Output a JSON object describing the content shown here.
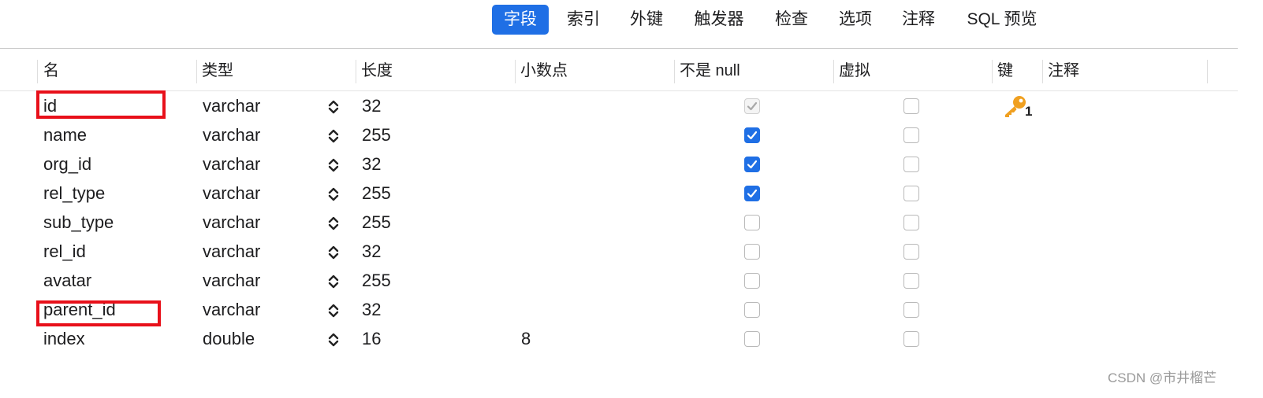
{
  "tabs": [
    {
      "label": "字段",
      "active": true
    },
    {
      "label": "索引",
      "active": false
    },
    {
      "label": "外键",
      "active": false
    },
    {
      "label": "触发器",
      "active": false
    },
    {
      "label": "检查",
      "active": false
    },
    {
      "label": "选项",
      "active": false
    },
    {
      "label": "注释",
      "active": false
    },
    {
      "label": "SQL 预览",
      "active": false
    }
  ],
  "columns": {
    "name": "名",
    "type": "类型",
    "length": "长度",
    "decimals": "小数点",
    "not_null": "不是 null",
    "virtual": "虚拟",
    "key": "键",
    "comment": "注释"
  },
  "fields": [
    {
      "name": "id",
      "type": "varchar",
      "length": "32",
      "decimals": "",
      "not_null": true,
      "not_null_disabled": true,
      "virtual": false,
      "key": "1",
      "comment": "",
      "highlighted": true
    },
    {
      "name": "name",
      "type": "varchar",
      "length": "255",
      "decimals": "",
      "not_null": true,
      "not_null_disabled": false,
      "virtual": false,
      "key": "",
      "comment": "",
      "highlighted": false
    },
    {
      "name": "org_id",
      "type": "varchar",
      "length": "32",
      "decimals": "",
      "not_null": true,
      "not_null_disabled": false,
      "virtual": false,
      "key": "",
      "comment": "",
      "highlighted": false
    },
    {
      "name": "rel_type",
      "type": "varchar",
      "length": "255",
      "decimals": "",
      "not_null": true,
      "not_null_disabled": false,
      "virtual": false,
      "key": "",
      "comment": "",
      "highlighted": false
    },
    {
      "name": "sub_type",
      "type": "varchar",
      "length": "255",
      "decimals": "",
      "not_null": false,
      "not_null_disabled": false,
      "virtual": false,
      "key": "",
      "comment": "",
      "highlighted": false
    },
    {
      "name": "rel_id",
      "type": "varchar",
      "length": "32",
      "decimals": "",
      "not_null": false,
      "not_null_disabled": false,
      "virtual": false,
      "key": "",
      "comment": "",
      "highlighted": false
    },
    {
      "name": "avatar",
      "type": "varchar",
      "length": "255",
      "decimals": "",
      "not_null": false,
      "not_null_disabled": false,
      "virtual": false,
      "key": "",
      "comment": "",
      "highlighted": false
    },
    {
      "name": "parent_id",
      "type": "varchar",
      "length": "32",
      "decimals": "",
      "not_null": false,
      "not_null_disabled": false,
      "virtual": false,
      "key": "",
      "comment": "",
      "highlighted": true
    },
    {
      "name": "index",
      "type": "double",
      "length": "16",
      "decimals": "8",
      "not_null": false,
      "not_null_disabled": false,
      "virtual": false,
      "key": "",
      "comment": "",
      "highlighted": false
    }
  ],
  "icons": {
    "stepper": "chevron-up-down-icon",
    "key": "primary-key-icon",
    "check": "checkmark-icon"
  },
  "colors": {
    "accent": "#1f6fe5",
    "highlight_box": "#e8101a",
    "key_icon": "#f0a020"
  },
  "watermark": "CSDN @市井榴芒"
}
